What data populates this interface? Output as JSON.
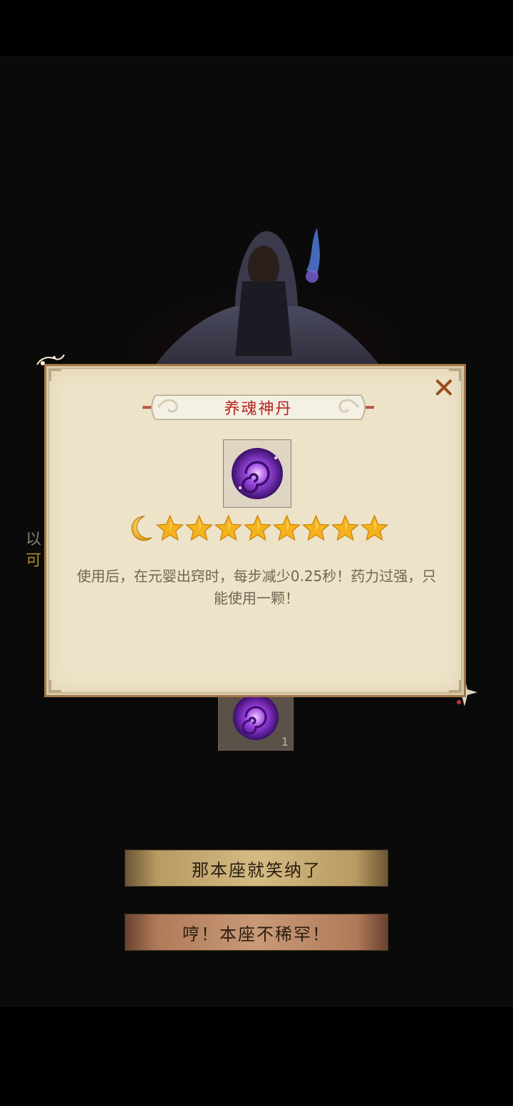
{
  "background": {
    "partial_text_line1": "以",
    "partial_text_line2": "可"
  },
  "item_popup": {
    "title": "养魂神丹",
    "icon": "purple-soul-pill-icon",
    "rating": {
      "moons": 1,
      "stars": 8
    },
    "description": "使用后，在元婴出窍时，每步减少0.25秒！药力过强，只能使用一颗！"
  },
  "reward": {
    "icon": "purple-soul-pill-icon",
    "count": "1"
  },
  "buttons": {
    "accept_label": "那本座就笑纳了",
    "decline_label": "哼！本座不稀罕！"
  },
  "colors": {
    "title_red": "#b8231d",
    "panel_bg": "#ede3c8",
    "panel_border": "#a0754a",
    "star_gold": "#f4b21b",
    "pill_purple": "#7a2ad0"
  }
}
